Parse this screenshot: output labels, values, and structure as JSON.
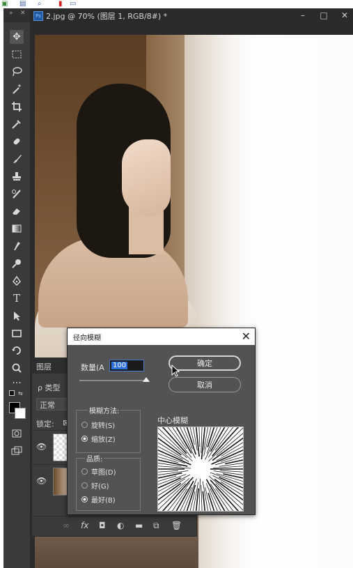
{
  "document": {
    "title": "2.jpg @ 70% (图层 1, RGB/8#) *",
    "window_controls": [
      "–",
      "□",
      "✕"
    ]
  },
  "toolbar": {
    "tools": [
      "move-tool",
      "marquee-tool",
      "lasso-tool",
      "magic-wand-tool",
      "crop-tool",
      "eyedropper-tool",
      "healing-brush-tool",
      "brush-tool",
      "clone-stamp-tool",
      "history-brush-tool",
      "eraser-tool",
      "gradient-tool",
      "smudge-tool",
      "dodge-tool",
      "pen-tool",
      "type-tool",
      "path-selection-tool",
      "rectangle-tool",
      "rotate-view-tool",
      "zoom-tool",
      "more-tools"
    ]
  },
  "layers_panel": {
    "tab_layers": "图层",
    "search_kind": "ρ 类型",
    "blend_mode": "正常",
    "lock_label": "锁定:"
  },
  "dialog": {
    "title": "径向模糊",
    "close": "✕",
    "amount_label": "数量(A",
    "amount_value": "100",
    "amount_fraction": 1.0,
    "ok_label": "确定",
    "cancel_label": "取消",
    "method_legend": "模糊方法:",
    "method_spin": "旋转(S)",
    "method_zoom": "缩放(Z)",
    "method_selected": "zoom",
    "quality_legend": "品质:",
    "quality_draft": "草图(D)",
    "quality_good": "好(G)",
    "quality_best": "最好(B)",
    "quality_selected": "best",
    "preview_label": "中心模糊"
  },
  "colors": {
    "ui_dark": "#2b2b2b",
    "toolbar": "#3a3a3a",
    "dialog_bg": "#535353",
    "accent": "#2d6fdc"
  }
}
